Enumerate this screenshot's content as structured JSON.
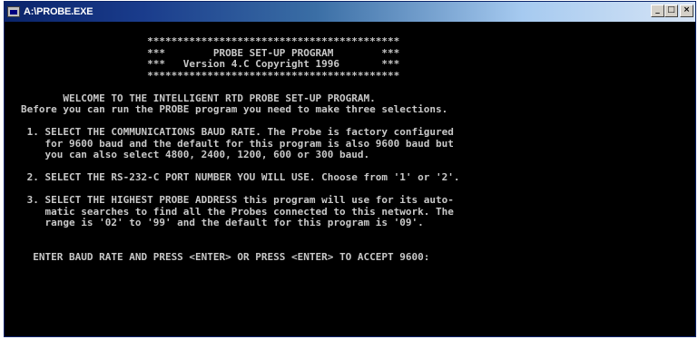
{
  "window": {
    "title": "A:\\PROBE.EXE",
    "minimize_label": "_",
    "maximize_label": "□",
    "close_label": "×"
  },
  "console": {
    "banner": [
      "                     ******************************************",
      "                     ***        PROBE SET-UP PROGRAM        ***",
      "                     ***   Version 4.C Copyright 1996       ***",
      "                     ******************************************"
    ],
    "welcome": [
      "       WELCOME TO THE INTELLIGENT RTD PROBE SET-UP PROGRAM.",
      "Before you can run the PROBE program you need to make three selections."
    ],
    "step1": [
      " 1. SELECT THE COMMUNICATIONS BAUD RATE. The Probe is factory configured",
      "    for 9600 baud and the default for this program is also 9600 baud but",
      "    you can also select 4800, 2400, 1200, 600 or 300 baud."
    ],
    "step2": [
      " 2. SELECT THE RS-232-C PORT NUMBER YOU WILL USE. Choose from '1' or '2'."
    ],
    "step3": [
      " 3. SELECT THE HIGHEST PROBE ADDRESS this program will use for its auto-",
      "    matic searches to find all the Probes connected to this network. The",
      "    range is '02' to '99' and the default for this program is '09'."
    ],
    "prompt": "  ENTER BAUD RATE AND PRESS <ENTER> OR PRESS <ENTER> TO ACCEPT 9600:"
  }
}
